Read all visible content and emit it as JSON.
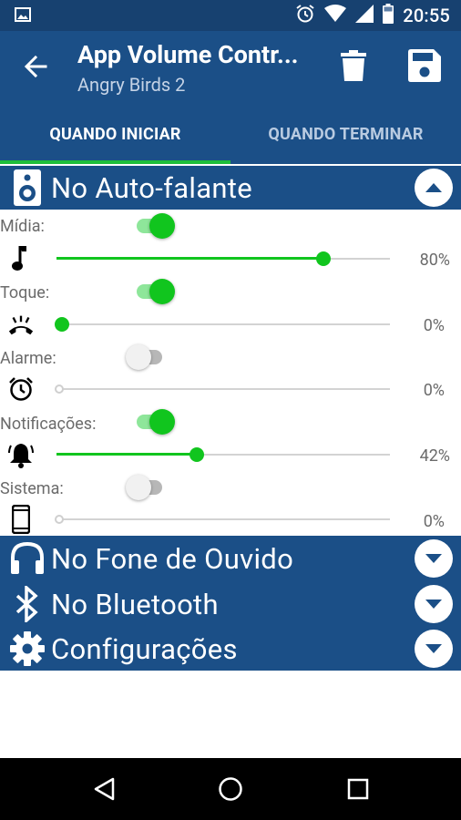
{
  "status_bar": {
    "time": "20:55",
    "icons": [
      "image-icon",
      "alarm-icon",
      "wifi-icon",
      "signal-icon",
      "battery-icon"
    ]
  },
  "app_bar": {
    "title": "App Volume Contr...",
    "subtitle": "Angry Birds 2",
    "actions": [
      "trash-icon",
      "save-icon"
    ]
  },
  "tabs": [
    {
      "label": "QUANDO INICIAR",
      "active": true
    },
    {
      "label": "QUANDO TERMINAR",
      "active": false
    }
  ],
  "speaker_section": {
    "label": "No Auto-falante",
    "icon": "speaker-icon",
    "expanded": true,
    "rows": [
      {
        "label": "Mídia:",
        "enabled": true,
        "icon": "music-note-icon",
        "value": 0.8,
        "percent": "80%"
      },
      {
        "label": "Toque:",
        "enabled": true,
        "icon": "ring-volume-icon",
        "value": 0.0,
        "percent": "0%"
      },
      {
        "label": "Alarme:",
        "enabled": false,
        "icon": "alarm-clock-icon",
        "value": 0.0,
        "percent": "0%"
      },
      {
        "label": "Notificações:",
        "enabled": true,
        "icon": "notification-bell-icon",
        "value": 0.42,
        "percent": "42%"
      },
      {
        "label": "Sistema:",
        "enabled": false,
        "icon": "smartphone-icon",
        "value": 0.0,
        "percent": "0%"
      }
    ]
  },
  "collapsed_sections": [
    {
      "label": "No Fone de Ouvido",
      "icon": "headphones-icon"
    },
    {
      "label": "No Bluetooth",
      "icon": "bluetooth-icon"
    },
    {
      "label": "Configurações",
      "icon": "settings-gear-icon"
    }
  ],
  "colors": {
    "primary": "#1b4f87",
    "status_bar": "#174170",
    "accent_green": "#11c51e"
  },
  "nav_bar": [
    "back-nav-icon",
    "home-nav-icon",
    "recents-nav-icon"
  ]
}
